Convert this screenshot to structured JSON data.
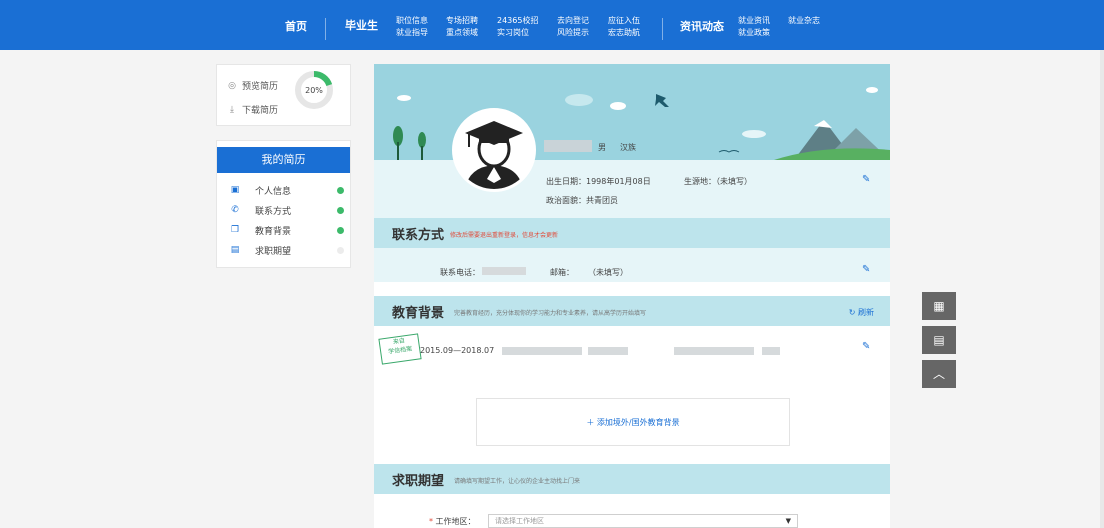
{
  "nav": {
    "home": "首页",
    "graduates": "毕业生",
    "graduate_links": [
      [
        "职位信息",
        "就业指导"
      ],
      [
        "专场招聘",
        "重点领域"
      ],
      [
        "24365校招",
        "实习岗位"
      ],
      [
        "去向登记",
        "风险提示"
      ],
      [
        "应征入伍",
        "宏志助航"
      ]
    ],
    "news": "资讯动态",
    "news_links": [
      [
        "就业资讯",
        "就业政策"
      ],
      [
        "就业杂志",
        ""
      ]
    ]
  },
  "sidebar": {
    "preview": "预览简历",
    "download": "下载简历",
    "completion": "20%",
    "completion_value": 0.2,
    "my_resume": "我的简历",
    "items": [
      {
        "label": "个人信息",
        "status": "complete"
      },
      {
        "label": "联系方式",
        "status": "complete"
      },
      {
        "label": "教育背景",
        "status": "complete"
      },
      {
        "label": "求职期望",
        "status": "incomplete"
      }
    ]
  },
  "profile": {
    "gender": "男",
    "ethnicity": "汉族",
    "birth_date": "出生日期：1998年01月08日",
    "birthplace": "生源地：（未填写）",
    "political_status": "政治面貌：共青团员"
  },
  "contact": {
    "title": "联系方式",
    "note": "修改后需要退出重新登录，信息才会更新",
    "phone_label": "联系电话：",
    "email_label": "邮箱：",
    "email_value": "（未填写）"
  },
  "education": {
    "title": "教育背景",
    "note": "完善教育经历，充分体现你的学习能力和专业素养，请从高学历开始填写",
    "refresh": "刷新",
    "stamp": "来自\n学信档案",
    "period": "2015.09—2018.07",
    "add_label": "＋ 添加境外/国外教育背景"
  },
  "expectation": {
    "title": "求职期望",
    "note": "请确填写期望工作，让心仪的企业主动找上门来",
    "region_label": "工作地区：",
    "region_placeholder": "请选择工作地区"
  },
  "colors": {
    "brand": "#1a6fd4",
    "complete": "#3cba6a",
    "incomplete": "#e8e8e8"
  }
}
